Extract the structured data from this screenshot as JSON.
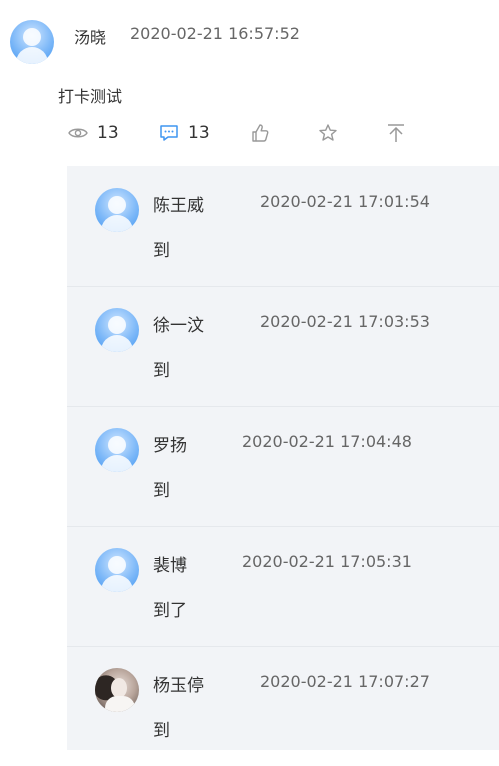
{
  "post": {
    "author": "汤晓",
    "time": "2020-02-21 16:57:52",
    "content": "打卡测试",
    "views": "13",
    "comments": "13"
  },
  "icons": {
    "views": "eye-icon",
    "comments": "comment-icon",
    "like": "thumbs-up-icon",
    "favorite": "star-icon",
    "top": "pin-to-top-icon"
  },
  "colors": {
    "accent": "#3f95f1",
    "reply_bg": "#f2f4f7"
  },
  "replies": [
    {
      "name": "陈王威",
      "time": "2020-02-21 17:01:54",
      "text": "到",
      "avatar": "default-avatar"
    },
    {
      "name": "徐一汶",
      "time": "2020-02-21 17:03:53",
      "text": "到",
      "avatar": "default-avatar"
    },
    {
      "name": "罗扬",
      "time": "2020-02-21 17:04:48",
      "text": "到",
      "avatar": "default-avatar"
    },
    {
      "name": "裴博",
      "time": "2020-02-21 17:05:31",
      "text": "到了",
      "avatar": "default-avatar"
    },
    {
      "name": "杨玉停",
      "time": "2020-02-21 17:07:27",
      "text": "到",
      "avatar": "photo-avatar"
    }
  ]
}
